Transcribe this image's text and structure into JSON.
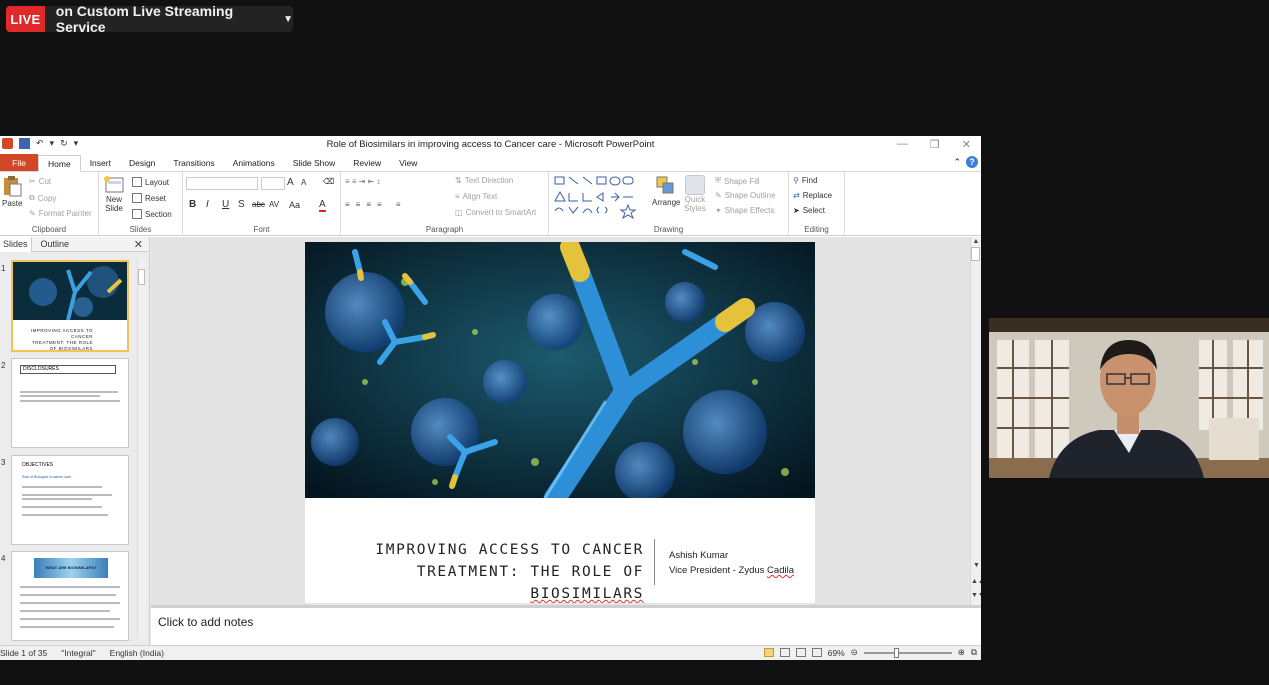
{
  "live": {
    "badge": "LIVE",
    "service": "on Custom Live Streaming Service"
  },
  "window": {
    "title": "Role of Biosimilars in improving access to Cancer care - Microsoft PowerPoint"
  },
  "tabs": {
    "file": "File",
    "items": [
      "Home",
      "Insert",
      "Design",
      "Transitions",
      "Animations",
      "Slide Show",
      "Review",
      "View"
    ]
  },
  "ribbon": {
    "clipboard": {
      "paste": "Paste",
      "cut": "Cut",
      "copy": "Copy",
      "format_painter": "Format Painter",
      "label": "Clipboard"
    },
    "slides": {
      "new_slide_1": "New",
      "new_slide_2": "Slide",
      "layout": "Layout",
      "reset": "Reset",
      "section": "Section",
      "label": "Slides"
    },
    "font": {
      "label": "Font",
      "bold": "B",
      "italic": "I",
      "underline": "U",
      "strike": "S",
      "abc": "abc",
      "av": "AV",
      "aa": "Aa",
      "grow": "A",
      "shrink": "A"
    },
    "paragraph": {
      "text_direction": "Text Direction",
      "align_text": "Align Text",
      "convert": "Convert to SmartArt",
      "label": "Paragraph"
    },
    "drawing": {
      "arrange": "Arrange",
      "quick_styles_1": "Quick",
      "quick_styles_2": "Styles",
      "shape_fill": "Shape Fill",
      "shape_outline": "Shape Outline",
      "shape_effects": "Shape Effects",
      "label": "Drawing"
    },
    "editing": {
      "find": "Find",
      "replace": "Replace",
      "select": "Select",
      "label": "Editing"
    }
  },
  "panel": {
    "tab_slides": "Slides",
    "tab_outline": "Outline",
    "thumbs": [
      {
        "num": "1",
        "line1": "IMPROVING ACCESS TO CANCER",
        "line2": "TREATMENT: THE ROLE OF BIOSIMILARS"
      },
      {
        "num": "2",
        "title": "DISCLOSURES"
      },
      {
        "num": "3",
        "title": "OBJECTIVES",
        "sub": "Role of Biologics in cancer care"
      },
      {
        "num": "4",
        "title": "WHAT ARE BIOSIMILARS?"
      }
    ]
  },
  "slide": {
    "title_line1": "IMPROVING ACCESS TO CANCER",
    "title_line2a": "TREATMENT: THE ROLE OF ",
    "title_line2b": "BIOSIMILARS",
    "author_name": "Ashish Kumar",
    "author_role_a": "Vice President - Zydus ",
    "author_role_b": "Cadila"
  },
  "notes": {
    "placeholder": "Click to add notes"
  },
  "status": {
    "slide_of": "Slide 1 of 35",
    "theme": "\"Integral\"",
    "language": "English (India)",
    "zoom": "69%"
  }
}
